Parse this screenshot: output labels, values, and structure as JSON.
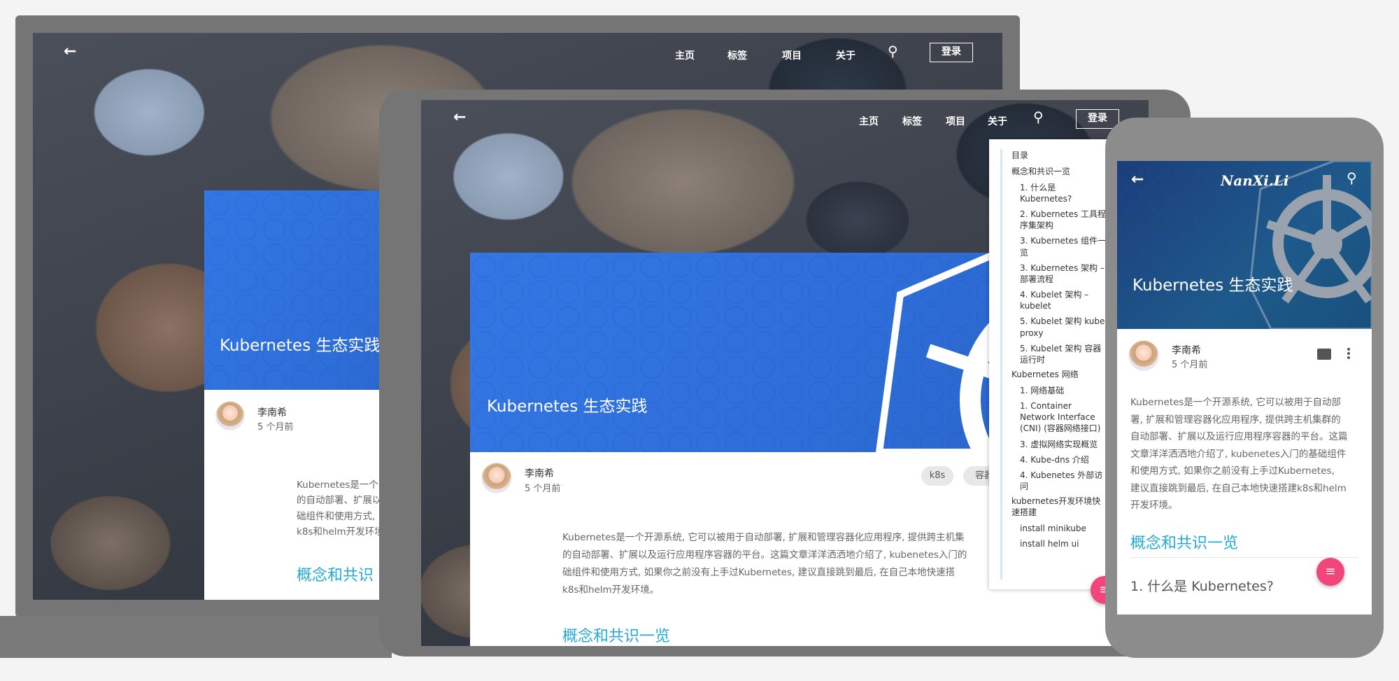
{
  "nav": {
    "back": "←",
    "home": "主页",
    "tags": "标签",
    "projects": "项目",
    "about": "关于",
    "search": "⚲",
    "login": "登录"
  },
  "post": {
    "title": "Kubernetes 生态实践",
    "author": "李南希",
    "time": "5 个月前",
    "tags": [
      "k8s",
      "容器"
    ],
    "intro_desktop": [
      "Kubernetes是一个",
      "的自动部署、扩展以",
      "础组件和使用方式,",
      "k8s和helm开发环境"
    ],
    "intro_tablet": [
      "Kubernetes是一个开源系统, 它可以被用于自动部署, 扩展和管理容器化应用程序, 提供跨主机集",
      "的自动部署、扩展以及运行应用程序容器的平台。这篇文章洋洋洒洒地介绍了, kubenetes入门的",
      "础组件和使用方式, 如果你之前没有上手过Kubernetes, 建议直接跳到最后, 在自己本地快速搭",
      "k8s和helm开发环境。"
    ],
    "intro_phone": [
      "Kubernetes是一个开源系统, 它可以被用于自动部",
      "署, 扩展和管理容器化应用程序, 提供跨主机集群的",
      "自动部署、扩展以及运行应用程序容器的平台。这篇",
      "文章洋洋洒洒地介绍了, kubenetes入门的基础组件",
      "和使用方式, 如果你之前没有上手过Kubernetes,",
      "建议直接跳到最后, 在自己本地快速搭建k8s和helm",
      "开发环境。"
    ],
    "section1": "概念和共识一览",
    "section1_desktop": "概念和共识",
    "subsection1": "1. 什么是 Kubernetes?"
  },
  "phone": {
    "brand": "NanXi.Li",
    "title": "Kubernetes 生态实践"
  },
  "toc": {
    "title": "目录",
    "items": [
      {
        "level": "h",
        "text": "概念和共识一览"
      },
      {
        "level": "s",
        "text": "1. 什么是 Kubernetes?"
      },
      {
        "level": "s",
        "text": "2. Kubernetes 工具程序集架构"
      },
      {
        "level": "s",
        "text": "3. Kubernetes 组件一览"
      },
      {
        "level": "s",
        "text": "3. Kubernetes 架构 – 部署流程"
      },
      {
        "level": "s",
        "text": "4. Kubelet 架构 – kubelet"
      },
      {
        "level": "s",
        "text": "5. Kubelet 架构 kube-proxy"
      },
      {
        "level": "s",
        "text": "5. Kubelet 架构 容器运行时"
      },
      {
        "level": "h",
        "text": "Kubernetes 网络"
      },
      {
        "level": "s",
        "text": "1. 网络基础"
      },
      {
        "level": "s",
        "text": "1. Container Network Interface (CNI) (容器网络接口)"
      },
      {
        "level": "s",
        "text": "3. 虚拟网络实现概览"
      },
      {
        "level": "s",
        "text": "4. Kube-dns 介绍"
      },
      {
        "level": "s",
        "text": "4. Kubenetes 外部访问"
      },
      {
        "level": "h",
        "text": "kubernetes开发环境快速搭建"
      },
      {
        "level": "s",
        "text": "install minikube"
      },
      {
        "level": "s",
        "text": "install helm ui"
      }
    ]
  },
  "fab": "≡"
}
